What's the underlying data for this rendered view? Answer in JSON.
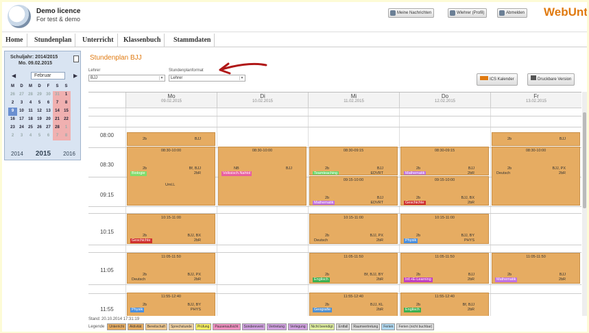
{
  "header": {
    "licence_title": "Demo licence",
    "licence_sub": "For test & demo",
    "buttons": [
      {
        "label": "Meine Nachrichten",
        "icon": "mail-icon"
      },
      {
        "label": "Wlehrer (Profil)",
        "icon": "profile-icon"
      },
      {
        "label": "Abmelden",
        "icon": "logout-icon"
      }
    ],
    "brand": "WebUntis",
    "brand_color": "#e07a10"
  },
  "nav": [
    "Home",
    "Stundenplan",
    "Unterricht",
    "Klassenbuch",
    "Stammdaten"
  ],
  "sidebar": {
    "schoolyear": "Schuljahr: 2014/2015",
    "date": "Mo. 09.02.2015",
    "month": "Februar",
    "weekdays": [
      "M",
      "D",
      "M",
      "D",
      "F",
      "S",
      "S"
    ],
    "weeks": [
      [
        "26",
        "27",
        "28",
        "29",
        "30",
        "31",
        "1"
      ],
      [
        "2",
        "3",
        "4",
        "5",
        "6",
        "7",
        "8"
      ],
      [
        "9",
        "10",
        "11",
        "12",
        "13",
        "14",
        "15"
      ],
      [
        "16",
        "17",
        "18",
        "19",
        "20",
        "21",
        "22"
      ],
      [
        "23",
        "24",
        "25",
        "26",
        "27",
        "28",
        "1"
      ],
      [
        "2",
        "3",
        "4",
        "5",
        "6",
        "7",
        "8"
      ]
    ],
    "years": [
      "2014",
      "2015",
      "2016"
    ]
  },
  "main": {
    "title": "Stundenplan BJJ",
    "filter1_label": "Lehrer",
    "filter1_value": "BJJ",
    "filter2_label": "Stundenplanformat",
    "filter2_value": "Lehrer",
    "ics_button": "ICS Kalender",
    "print_button": "Druckbare Version"
  },
  "timetable": {
    "days": [
      {
        "name": "Mo",
        "date": "09.02.2015"
      },
      {
        "name": "Di",
        "date": "10.02.2015"
      },
      {
        "name": "Mi",
        "date": "11.02.2015"
      },
      {
        "name": "Do",
        "date": "12.02.2015"
      },
      {
        "name": "Fr",
        "date": "13.02.2015"
      }
    ],
    "times": [
      "08:00",
      "08:30",
      "09:15",
      "10:15",
      "11:05",
      "11:55"
    ],
    "lessons": [
      {
        "day": 0,
        "slot": "a",
        "time": "",
        "klass": "2b",
        "teacher": "BJJ",
        "subject": "",
        "room": "",
        "color": ""
      },
      {
        "day": 4,
        "slot": "a",
        "time": "",
        "klass": "2b",
        "teacher": "BJJ",
        "subject": "",
        "room": "",
        "color": ""
      },
      {
        "day": 0,
        "slot": "b",
        "time": "08:30-10:00",
        "klass": "2b",
        "teacher": "Bf, BJJ",
        "subject": "Biologie",
        "room": "2bR",
        "extra": "Uml.L",
        "color": "#7fdc6a"
      },
      {
        "day": 1,
        "slot": "b",
        "time": "08:30-10:00",
        "klass": "NB",
        "teacher": "BJJ",
        "subject": "Volksisch.Nahtol",
        "room": "",
        "color": "#e85fa0"
      },
      {
        "day": 2,
        "slot": "b1",
        "time": "08:30-09:15",
        "klass": "2b",
        "teacher": "BJJ",
        "subject": "Teamteaching",
        "room": "EDVRT",
        "color": "#6ad86a"
      },
      {
        "day": 3,
        "slot": "b1",
        "time": "08:30-09:15",
        "klass": "2b",
        "teacher": "BJJ",
        "subject": "Mathematik",
        "room": "2bR",
        "color": "#c070e0"
      },
      {
        "day": 4,
        "slot": "b",
        "time": "08:30-10:00",
        "klass": "2b",
        "teacher": "BJJ, PX",
        "subject": "Deutsch",
        "room": "2bR",
        "color": ""
      },
      {
        "day": 2,
        "slot": "b2",
        "time": "09:15-10:00",
        "klass": "2b",
        "teacher": "BJJ",
        "subject": "Mathematik",
        "room": "EDVRT",
        "color": "#c070e0"
      },
      {
        "day": 3,
        "slot": "b2",
        "time": "09:15-10:00",
        "klass": "2b",
        "teacher": "BJJ, BX",
        "subject": "Geschichte",
        "room": "2bR",
        "color": "#d03030"
      },
      {
        "day": 0,
        "slot": "c",
        "time": "10:15-11:00",
        "klass": "2b",
        "teacher": "BJJ, BX",
        "subject": "Geschichte",
        "room": "2bR",
        "color": "#d03030"
      },
      {
        "day": 2,
        "slot": "c",
        "time": "10:15-11:00",
        "klass": "2b",
        "teacher": "BJJ, PX",
        "subject": "Deutsch",
        "room": "2bR",
        "color": ""
      },
      {
        "day": 3,
        "slot": "c",
        "time": "10:15-11:00",
        "klass": "2b",
        "teacher": "BJJ, BY",
        "subject": "Physik",
        "room": "PHYS",
        "color": "#4a90e0"
      },
      {
        "day": 0,
        "slot": "d",
        "time": "11:05-11:50",
        "klass": "2b",
        "teacher": "BJJ, PX",
        "subject": "Deutsch",
        "room": "2bR",
        "color": ""
      },
      {
        "day": 2,
        "slot": "d",
        "time": "11:05-11:50",
        "klass": "2b",
        "teacher": "Bf, BJJ, BY",
        "subject": "Englisch",
        "room": "2bR",
        "color": "#3cb050"
      },
      {
        "day": 3,
        "slot": "d",
        "time": "11:05-11:50",
        "klass": "2b",
        "teacher": "BJJ",
        "subject": "Inf.+E-Learning",
        "room": "2bR",
        "color": "#c040c0"
      },
      {
        "day": 4,
        "slot": "d",
        "time": "11:05-11:50",
        "klass": "2b",
        "teacher": "BJJ",
        "subject": "Mathematik",
        "room": "2bR",
        "color": "#c070e0"
      },
      {
        "day": 0,
        "slot": "e",
        "time": "11:55-12:40",
        "klass": "2b",
        "teacher": "BJJ, BY",
        "subject": "Physik",
        "room": "PHYS",
        "color": "#4a90e0"
      },
      {
        "day": 2,
        "slot": "e",
        "time": "11:55-12:40",
        "klass": "2b",
        "teacher": "BJJ, KL",
        "subject": "Geografie",
        "room": "2bR",
        "color": "#5090d0"
      },
      {
        "day": 3,
        "slot": "e",
        "time": "11:55-12:40",
        "klass": "2b",
        "teacher": "Bf, BJJ",
        "subject": "Englisch",
        "room": "2bR",
        "color": "#3cb050"
      }
    ]
  },
  "footer": {
    "stand": "Stand: 20.10.2014 17:31:19",
    "legend_title": "Legende",
    "legend": [
      {
        "label": "Unterricht",
        "color": "#e6ac62"
      },
      {
        "label": "Aktivität",
        "color": "#e6ac62"
      },
      {
        "label": "Bereitschaft",
        "color": "#f0c890"
      },
      {
        "label": "Sprechstunde",
        "color": "#f0d0a0"
      },
      {
        "label": "Prüfung",
        "color": "#f8f060"
      },
      {
        "label": "Pausenaufsicht",
        "color": "#f090c0"
      },
      {
        "label": "Sonderevent",
        "color": "#d0a0e0"
      },
      {
        "label": "Vertretung",
        "color": "#d0a0e0"
      },
      {
        "label": "Verlegung",
        "color": "#d0a0e0"
      },
      {
        "label": "Nicht beendigt",
        "color": "#e0f0a0"
      },
      {
        "label": "Entfall",
        "color": "#d8d8d8"
      },
      {
        "label": "Raumvertretung",
        "color": "#d8d8d8"
      },
      {
        "label": "Ferien",
        "color": "#b0d8f0"
      },
      {
        "label": "Ferien (nicht buchbar)",
        "color": "#e0e0e0"
      }
    ]
  }
}
